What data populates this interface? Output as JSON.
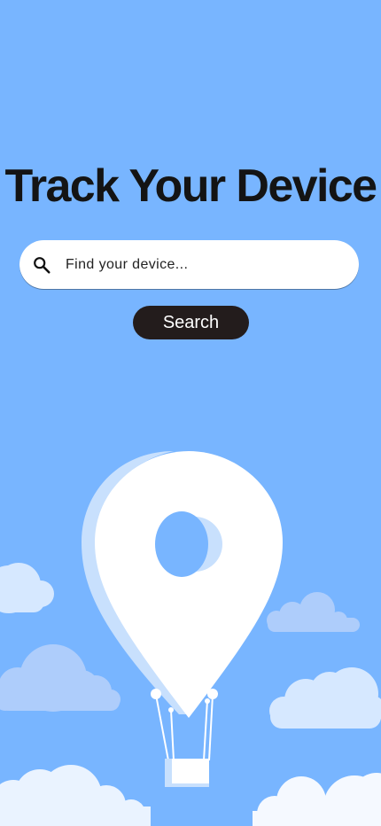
{
  "header": {
    "title": "Track Your Device"
  },
  "search": {
    "placeholder": "Find your device...",
    "button_label": "Search"
  },
  "icons": {
    "search": "search-icon",
    "illustration": "location-pin-balloon-illustration"
  },
  "colors": {
    "background": "#78b5ff",
    "button": "#231c1c",
    "pin": "#ffffff",
    "pin_shadow": "#c8e0fd",
    "cloud_light": "#d6e8ff",
    "cloud_mid": "#aecdfb"
  }
}
